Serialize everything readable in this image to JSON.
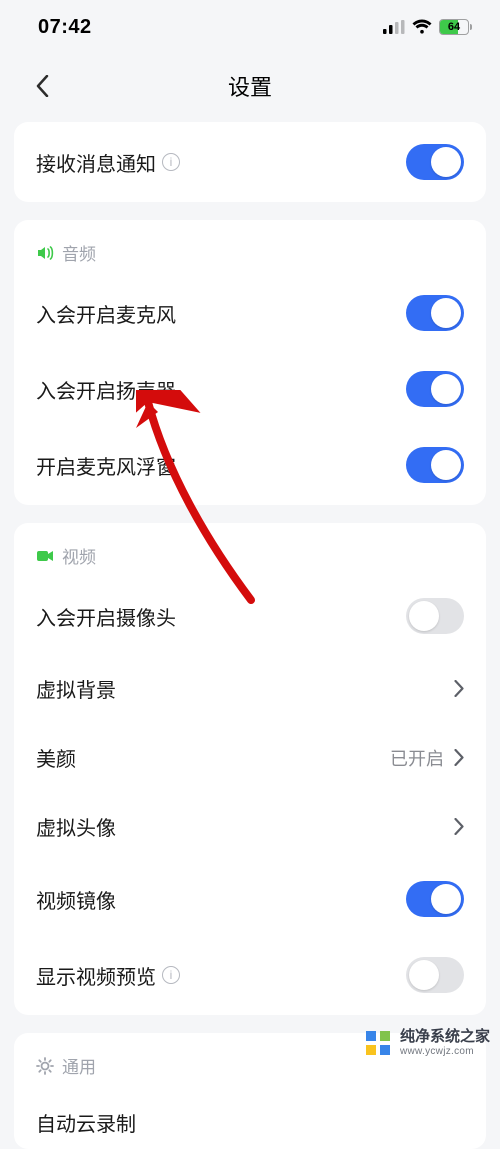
{
  "status_bar": {
    "time": "07:42",
    "battery_percent": "64"
  },
  "nav": {
    "title": "设置"
  },
  "notification": {
    "label": "接收消息通知",
    "on": true
  },
  "sections": {
    "audio": {
      "title": "音频",
      "items": {
        "mic_on_join": {
          "label": "入会开启麦克风",
          "on": true
        },
        "speaker_on_join": {
          "label": "入会开启扬声器",
          "on": true
        },
        "mic_float": {
          "label": "开启麦克风浮窗",
          "on": true
        }
      }
    },
    "video": {
      "title": "视频",
      "items": {
        "camera_on_join": {
          "label": "入会开启摄像头",
          "on": false
        },
        "virtual_bg": {
          "label": "虚拟背景"
        },
        "beauty": {
          "label": "美颜",
          "value": "已开启"
        },
        "virtual_avatar": {
          "label": "虚拟头像"
        },
        "video_mirror": {
          "label": "视频镜像",
          "on": true
        },
        "show_preview": {
          "label": "显示视频预览",
          "on": false
        }
      }
    },
    "general": {
      "title": "通用",
      "items": {
        "auto_cloud_record": {
          "label": "自动云录制"
        }
      }
    }
  },
  "watermark": {
    "line1": "纯净系统之家",
    "line2": "www.ycwjz.com"
  }
}
